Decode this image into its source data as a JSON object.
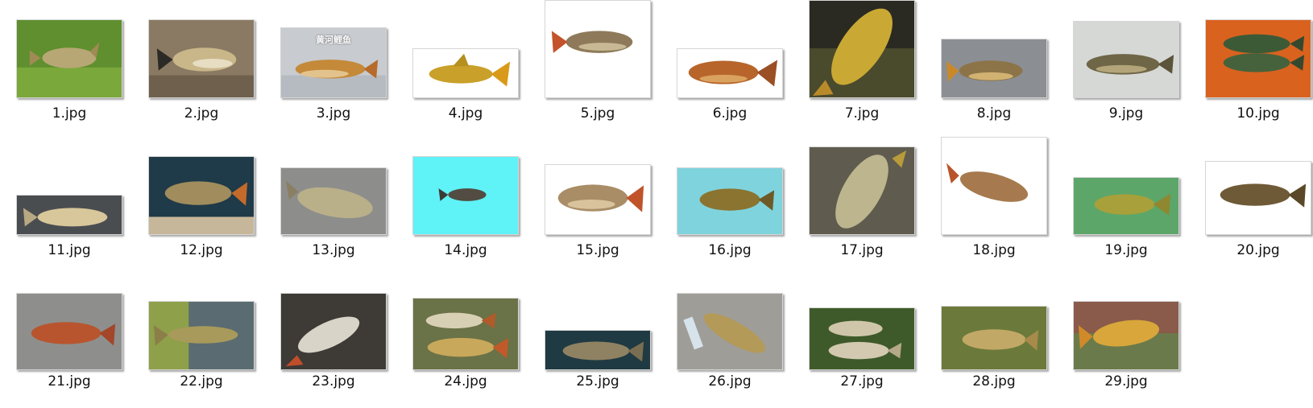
{
  "files": [
    {
      "name": "1.jpg"
    },
    {
      "name": "2.jpg"
    },
    {
      "name": "3.jpg",
      "overlay": "黄河鲤鱼"
    },
    {
      "name": "4.jpg"
    },
    {
      "name": "5.jpg"
    },
    {
      "name": "6.jpg"
    },
    {
      "name": "7.jpg"
    },
    {
      "name": "8.jpg"
    },
    {
      "name": "9.jpg"
    },
    {
      "name": "10.jpg"
    },
    {
      "name": "11.jpg"
    },
    {
      "name": "12.jpg"
    },
    {
      "name": "13.jpg"
    },
    {
      "name": "14.jpg"
    },
    {
      "name": "15.jpg"
    },
    {
      "name": "16.jpg"
    },
    {
      "name": "17.jpg"
    },
    {
      "name": "18.jpg"
    },
    {
      "name": "19.jpg"
    },
    {
      "name": "20.jpg"
    },
    {
      "name": "21.jpg"
    },
    {
      "name": "22.jpg"
    },
    {
      "name": "23.jpg"
    },
    {
      "name": "24.jpg"
    },
    {
      "name": "25.jpg"
    },
    {
      "name": "26.jpg"
    },
    {
      "name": "27.jpg"
    },
    {
      "name": "28.jpg"
    },
    {
      "name": "29.jpg"
    }
  ]
}
